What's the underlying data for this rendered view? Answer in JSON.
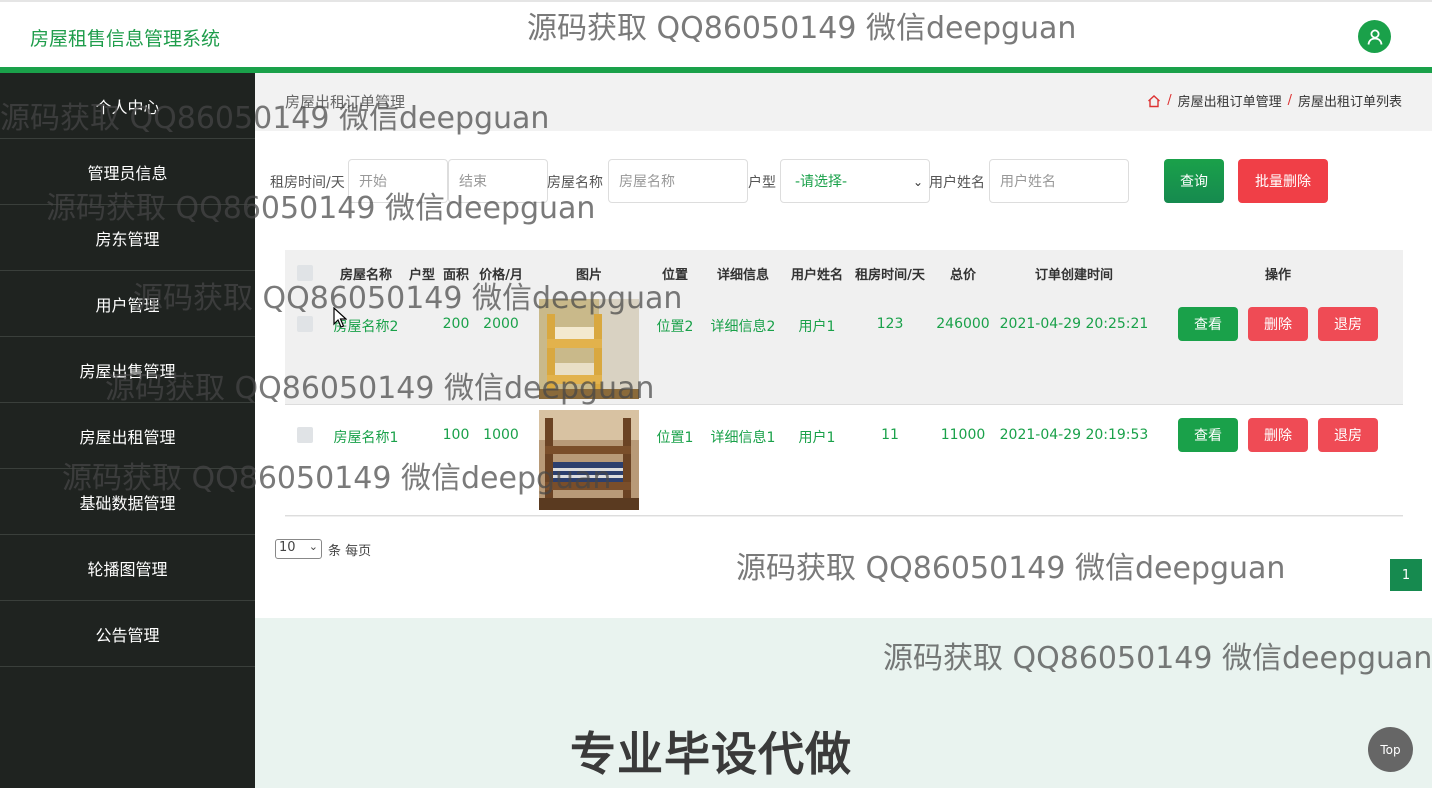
{
  "header": {
    "title": "房屋租售信息管理系统",
    "user_icon": "user-icon"
  },
  "sidebar": {
    "items": [
      {
        "label": "个人中心"
      },
      {
        "label": "管理员信息"
      },
      {
        "label": "房东管理"
      },
      {
        "label": "用户管理"
      },
      {
        "label": "房屋出售管理"
      },
      {
        "label": "房屋出租管理"
      },
      {
        "label": "基础数据管理"
      },
      {
        "label": "轮播图管理"
      },
      {
        "label": "公告管理"
      }
    ]
  },
  "page": {
    "title": "房屋出租订单管理",
    "breadcrumb": [
      "房屋出租订单管理",
      "房屋出租订单列表"
    ],
    "separator": "/"
  },
  "search": {
    "rent_days_label": "租房时间/天",
    "start_placeholder": "开始",
    "end_placeholder": "结束",
    "house_name_label": "房屋名称",
    "house_name_placeholder": "房屋名称",
    "type_label": "户型",
    "type_selected": "-请选择-",
    "user_name_label": "用户姓名",
    "user_name_placeholder": "用户姓名",
    "query_label": "查询",
    "batch_delete_label": "批量删除"
  },
  "table": {
    "columns": [
      "房屋名称",
      "户型",
      "面积",
      "价格/月",
      "图片",
      "位置",
      "详细信息",
      "用户姓名",
      "租房时间/天",
      "总价",
      "订单创建时间",
      "操作"
    ],
    "rows": [
      {
        "name": "房屋名称2",
        "type": "",
        "area": "200",
        "price": "2000",
        "location": "位置2",
        "detail": "详细信息2",
        "user": "用户1",
        "days": "123",
        "total": "246000",
        "created": "2021-04-29 20:25:21"
      },
      {
        "name": "房屋名称1",
        "type": "",
        "area": "100",
        "price": "1000",
        "location": "位置1",
        "detail": "详细信息1",
        "user": "用户1",
        "days": "11",
        "total": "11000",
        "created": "2021-04-29 20:19:53"
      }
    ],
    "actions": {
      "view": "查看",
      "delete": "删除",
      "checkout": "退房"
    }
  },
  "pager": {
    "page_size": "10",
    "per_page_text": "条 每页",
    "current_page": "1"
  },
  "overlay": {
    "watermark": "源码获取 QQ86050149 微信deepguan",
    "promo": "专业毕设代做",
    "top_button": "Top"
  },
  "colors": {
    "accent": "#1aa14a",
    "sidebar": "#1f2320",
    "danger": "#f03f47"
  }
}
